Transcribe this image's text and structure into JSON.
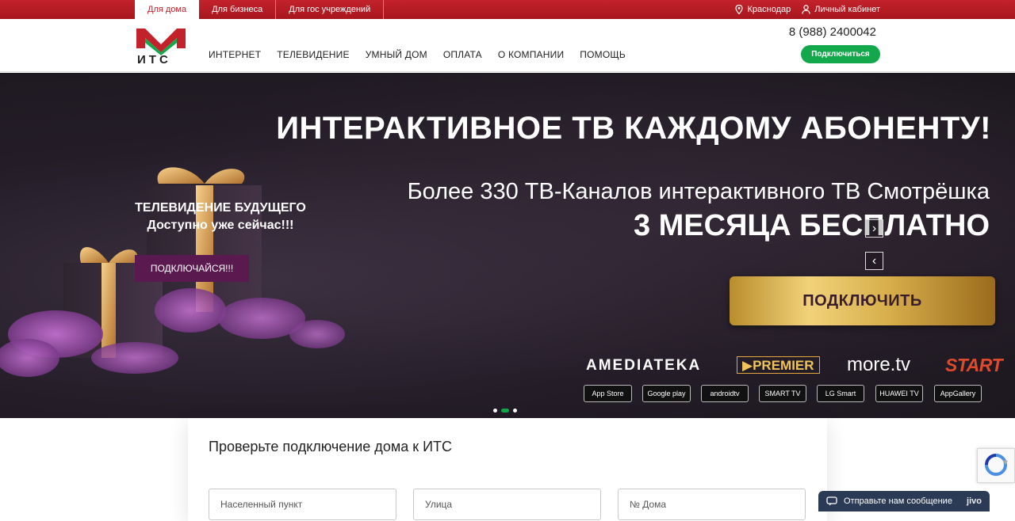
{
  "topbar": {
    "tabs": [
      "Для дома",
      "Для бизнеса",
      "Для гос учреждений"
    ],
    "city": "Краснодар",
    "cabinet": "Личный кабинет"
  },
  "header": {
    "logo_text": "ИТС",
    "nav": [
      "ИНТЕРНЕТ",
      "ТЕЛЕВИДЕНИЕ",
      "УМНЫЙ ДОМ",
      "ОПЛАТА",
      "О КОМПАНИИ",
      "ПОМОЩЬ"
    ],
    "phone": "8 (988) 2400042",
    "connect_label": "Подключиться"
  },
  "hero": {
    "title": "ИНТЕРАКТИВНОЕ ТВ КАЖДОМУ АБОНЕНТУ!",
    "subtitle": "Более 330 ТВ-Каналов интерактивного ТВ Смотрёшка",
    "free": "3 МЕСЯЦА БЕСПЛАТНО",
    "gold_button": "ПОДКЛЮЧИТЬ",
    "promo_line1": "ТЕЛЕВИДЕНИЕ БУДУЩЕГО",
    "promo_line2": "Доступно уже сейчас!!!",
    "promo_button": "ПОДКЛЮЧАЙСЯ!!!",
    "brands": [
      "AMEDIATEKA",
      "PREMIER",
      "more.tv",
      "START"
    ],
    "stores": [
      "App Store",
      "Google play",
      "androidtv",
      "SMART TV",
      "LG Smart",
      "HUAWEI TV",
      "AppGallery"
    ],
    "slide_count": 3,
    "active_slide": 2
  },
  "check": {
    "title": "Проверьте подключение дома к ИТС",
    "city_placeholder": "Населенный пункт",
    "street_placeholder": "Улица",
    "house_placeholder": "№ Дома"
  },
  "chat": {
    "label": "Отправьте нам сообщение",
    "brand": "jivo"
  },
  "colors": {
    "brand_red": "#c3222b",
    "accent_green": "#13a84b",
    "promo_purple": "#5a1a4f"
  }
}
